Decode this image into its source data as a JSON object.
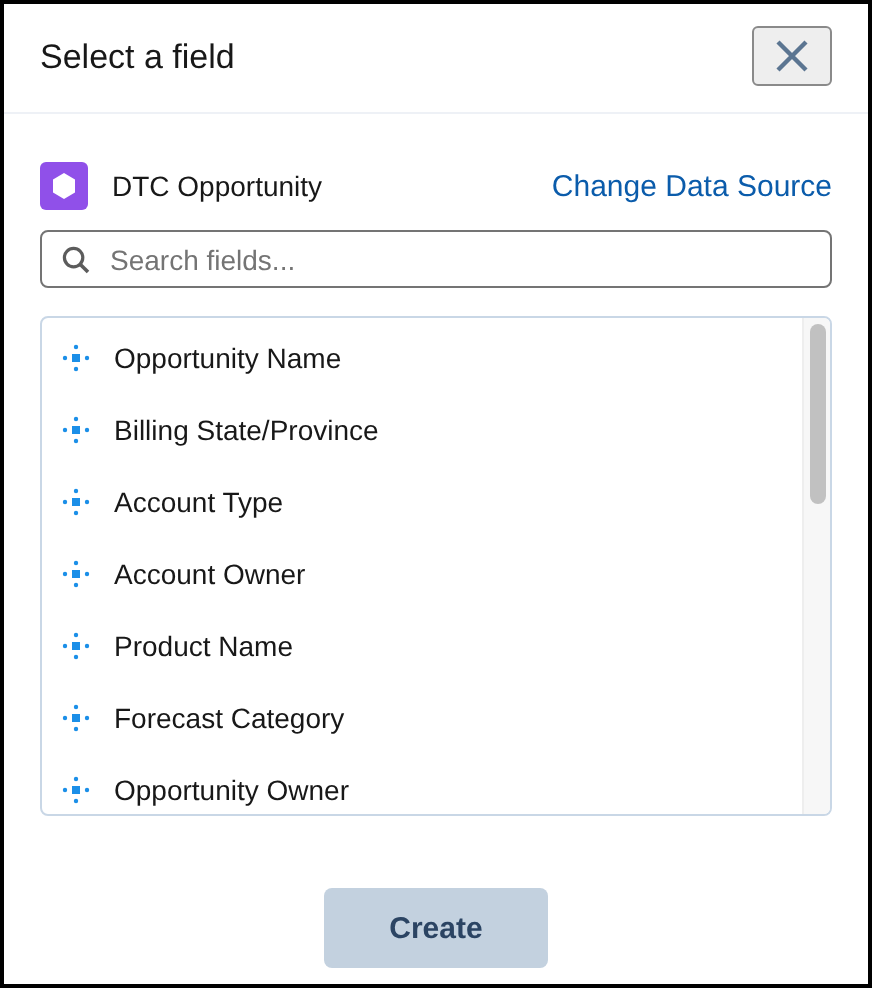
{
  "dialog": {
    "title": "Select a field"
  },
  "source": {
    "name": "DTC Opportunity",
    "link": "Change Data Source"
  },
  "search": {
    "placeholder": "Search fields..."
  },
  "fields": [
    {
      "label": "Opportunity Name"
    },
    {
      "label": "Billing State/Province"
    },
    {
      "label": "Account Type"
    },
    {
      "label": "Account Owner"
    },
    {
      "label": "Product Name"
    },
    {
      "label": "Forecast Category"
    },
    {
      "label": "Opportunity Owner"
    }
  ],
  "create_button": {
    "label": "Create",
    "disabled": true
  }
}
